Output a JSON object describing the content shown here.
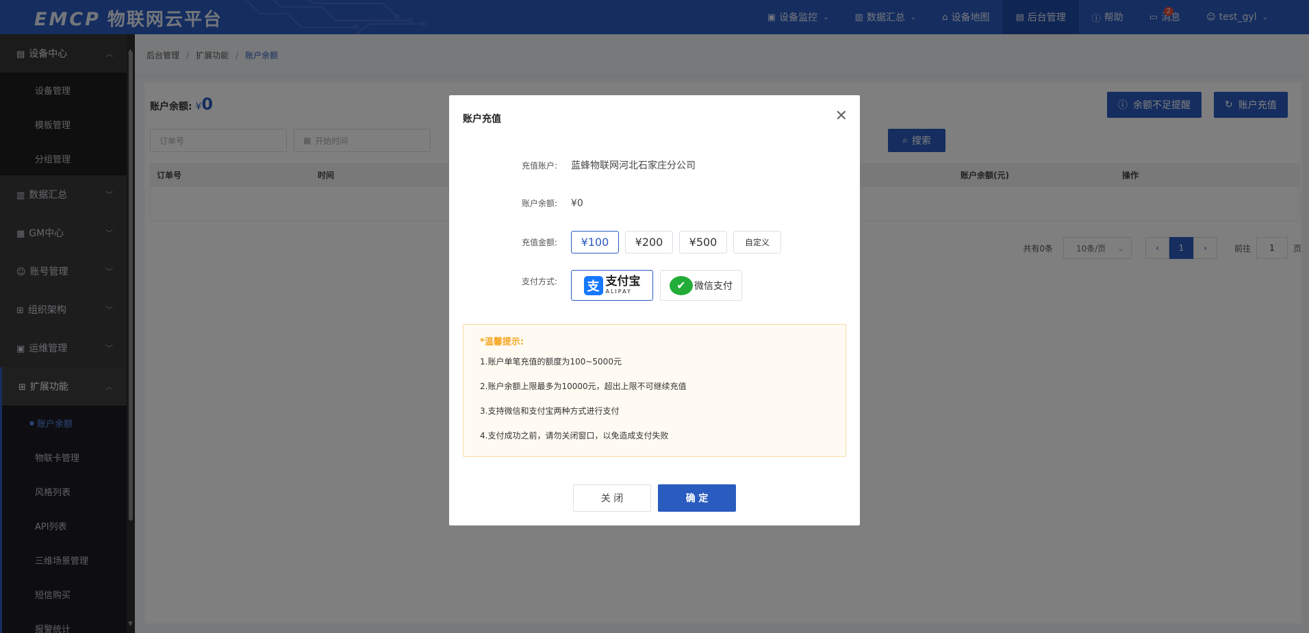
{
  "header": {
    "logo_en": "EMCP",
    "logo_cn": "物联网云平台",
    "nav": [
      {
        "label": "设备监控",
        "icon": "monitor-icon",
        "caret": true
      },
      {
        "label": "数据汇总",
        "icon": "chart-icon",
        "caret": true
      },
      {
        "label": "设备地图",
        "icon": "map-icon",
        "caret": false
      },
      {
        "label": "后台管理",
        "icon": "admin-icon",
        "caret": false
      },
      {
        "label": "帮助",
        "icon": "help-icon",
        "caret": false
      },
      {
        "label": "消息",
        "icon": "message-icon",
        "caret": false,
        "badge": "2"
      },
      {
        "label": "test_gyl",
        "icon": "user-icon",
        "caret": true
      }
    ],
    "accent": "#2a5bbf"
  },
  "sidebar": {
    "device_center": {
      "label": "设备中心",
      "items": [
        "设备管理",
        "模板管理",
        "分组管理"
      ]
    },
    "groups": [
      "数据汇总",
      "GM中心",
      "账号管理",
      "组织架构",
      "运维管理"
    ],
    "extension": {
      "label": "扩展功能",
      "items": [
        "账户余额",
        "物联卡管理",
        "风格列表",
        "API列表",
        "三维场景管理",
        "短信购买",
        "报警统计"
      ]
    }
  },
  "breadcrumb": [
    "后台管理",
    "扩展功能",
    "账户余额"
  ],
  "page": {
    "balance_label": "账户余额:",
    "currency": "¥",
    "balance_value": "0",
    "btn_low_balance": "余额不足提醒",
    "btn_recharge": "账户充值",
    "order_placeholder": "订单号",
    "start_time_placeholder": "开始时间",
    "search_label": "搜索",
    "columns": [
      "订单号",
      "时间",
      "账户余额(元)",
      "操作"
    ],
    "pager": {
      "total": "共有0条",
      "size": "10条/页",
      "page": "1",
      "goto_label": "前往",
      "goto_value": "1",
      "page_unit": "页"
    }
  },
  "dialog": {
    "title": "账户充值",
    "account_label": "充值账户:",
    "account_value": "蓝蜂物联网河北石家庄分公司",
    "balance_label": "账户余额:",
    "balance_value": "¥0",
    "amount_label": "充值金额:",
    "amounts": [
      "¥100",
      "¥200",
      "¥500"
    ],
    "custom_label": "自定义",
    "pay_label": "支付方式:",
    "alipay_cn": "支付宝",
    "alipay_en": "ALIPAY",
    "wechat_label": "微信支付",
    "tips_title": "*温馨提示:",
    "tips": [
      "1.账户单笔充值的额度为100~5000元",
      "2.账户余额上限最多为10000元，超出上限不可继续充值",
      "3.支持微信和支付宝两种方式进行支付",
      "4.支付成功之前，请勿关闭窗口，以免造成支付失败"
    ],
    "close_label": "关 闭",
    "confirm_label": "确 定"
  }
}
